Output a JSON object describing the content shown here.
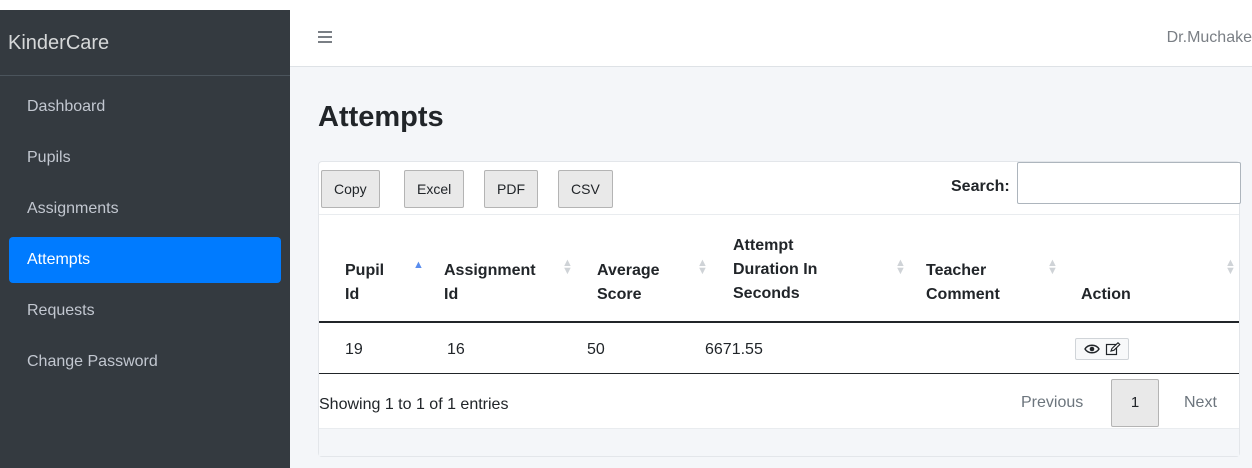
{
  "brand": "KinderCare",
  "sidebar": {
    "items": [
      {
        "label": "Dashboard"
      },
      {
        "label": "Pupils"
      },
      {
        "label": "Assignments"
      },
      {
        "label": "Attempts"
      },
      {
        "label": "Requests"
      },
      {
        "label": "Change Password"
      }
    ],
    "active_index": 3
  },
  "topbar": {
    "menu_icon": "hamburger-icon",
    "user": "Dr.Muchake"
  },
  "page": {
    "title": "Attempts"
  },
  "toolbar": {
    "copy": "Copy",
    "excel": "Excel",
    "pdf": "PDF",
    "csv": "CSV",
    "search_label": "Search:",
    "search_value": ""
  },
  "table": {
    "columns": [
      {
        "line1": "Pupil",
        "line2": "Id",
        "sort": "asc"
      },
      {
        "line1": "Assignment",
        "line2": "Id",
        "sort": "none"
      },
      {
        "line1": "Average",
        "line2": "Score",
        "sort": "none"
      },
      {
        "line1": "Attempt",
        "line2": "Duration In",
        "line3": "Seconds",
        "sort": "none"
      },
      {
        "line1": "Teacher",
        "line2": "Comment",
        "sort": "none"
      },
      {
        "line1": "Action",
        "sort": "none"
      }
    ],
    "rows": [
      {
        "pupil_id": "19",
        "assignment_id": "16",
        "average_score": "50",
        "duration": "6671.55",
        "teacher_comment": "",
        "actions": [
          "eye-icon",
          "edit-icon"
        ]
      }
    ]
  },
  "footer": {
    "info": "Showing 1 to 1 of 1 entries",
    "previous": "Previous",
    "page": "1",
    "next": "Next"
  },
  "colors": {
    "sidebar_bg": "#343a40",
    "accent": "#007bff",
    "content_bg": "#f4f6f9"
  }
}
